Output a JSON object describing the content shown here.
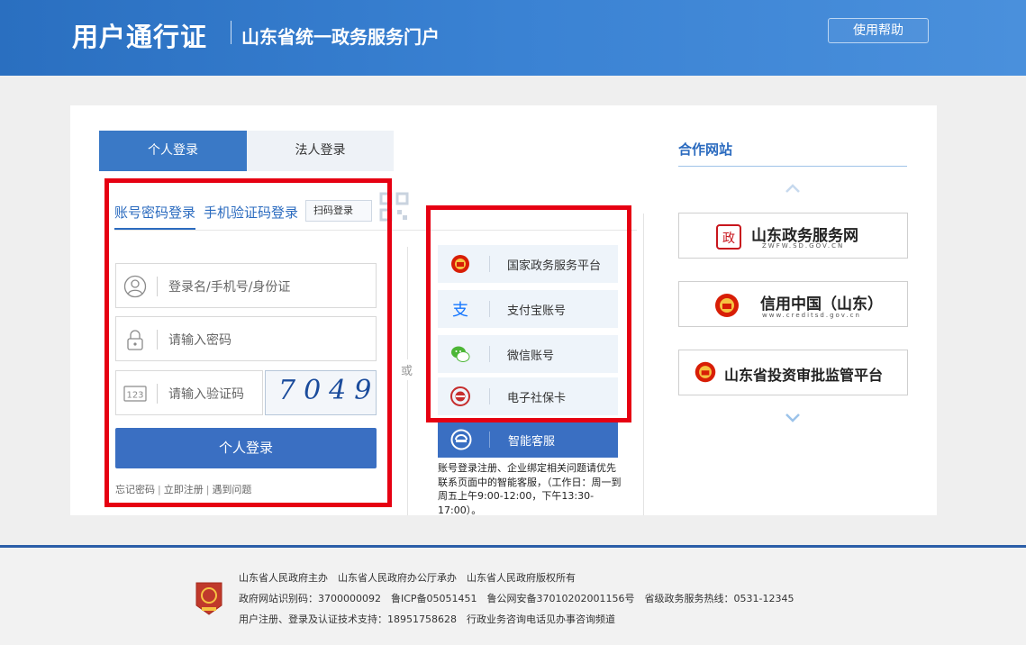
{
  "header": {
    "brand": "用户通行证",
    "subtitle": "山东省统一政务服务门户",
    "help_label": "使用帮助"
  },
  "login": {
    "tabs": {
      "personal": "个人登录",
      "legal": "法人登录"
    },
    "sub_tabs": {
      "account": "账号密码登录",
      "sms": "手机验证码登录",
      "scan": "扫码登录"
    },
    "username_placeholder": "登录名/手机号/身份证",
    "password_placeholder": "请输入密码",
    "code_placeholder": "请输入验证码",
    "captcha_value": "7049",
    "submit_label": "个人登录",
    "links": [
      "忘记密码",
      "立即注册",
      "遇到问题"
    ],
    "or_label": "或"
  },
  "third_party": {
    "items": [
      {
        "label": "国家政务服务平台",
        "icon": "national-emblem-icon"
      },
      {
        "label": "支付宝账号",
        "icon": "alipay-icon"
      },
      {
        "label": "微信账号",
        "icon": "wechat-icon"
      },
      {
        "label": "电子社保卡",
        "icon": "social-security-card-icon"
      }
    ],
    "kefu_label": "智能客服",
    "note": "账号登录注册、企业绑定相关问题请优先联系页面中的智能客服，（工作日：周一到周五上午9:00-12:00，下午13:30-17:00）。"
  },
  "partners": {
    "title": "合作网站",
    "items": [
      {
        "name": "山东政务服务网",
        "sub": "ZWFW.SD.GOV.CN"
      },
      {
        "name": "信用中国（山东）",
        "sub": "www.creditsd.gov.cn"
      },
      {
        "name": "山东省投资审批监管平台",
        "sub": ""
      }
    ]
  },
  "footer": {
    "line1": "山东省人民政府主办　山东省人民政府办公厅承办　山东省人民政府版权所有",
    "line2": "政府网站识别码：3700000092　鲁ICP备05051451　鲁公网安备37010202001156号　省级政务服务热线：0531-12345",
    "line3": "用户注册、登录及认证技术支持：18951758628　行政业务咨询电话见办事咨询频道"
  },
  "colors": {
    "header": "#3a82d3",
    "primary_button": "#3a6fc2",
    "link": "#2b6bbf",
    "highlight_box": "#e60012"
  }
}
